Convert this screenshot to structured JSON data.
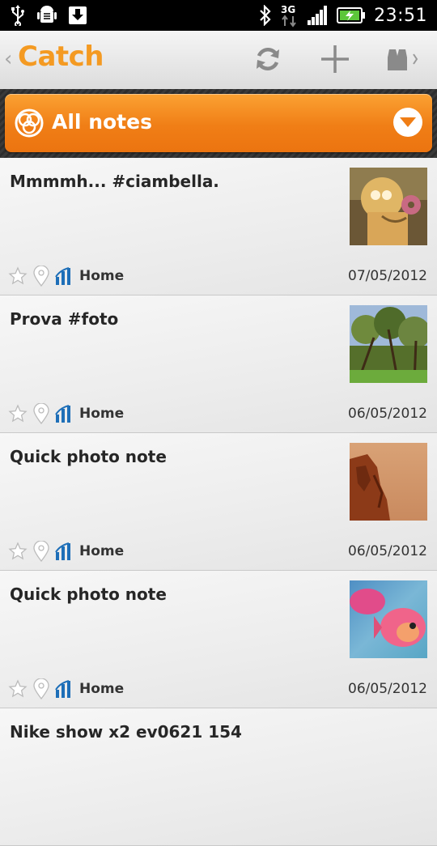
{
  "status_bar": {
    "time": "23:51",
    "network": "3G",
    "icons": [
      "usb-icon",
      "android-debug-icon",
      "download-icon",
      "bluetooth-icon",
      "network-3g-icon",
      "signal-icon",
      "battery-charging-icon"
    ]
  },
  "action_bar": {
    "title": "Catch",
    "actions": [
      "sync-icon",
      "add-icon",
      "search-binoculars-icon"
    ],
    "brand_color": "#f49a22"
  },
  "filter": {
    "label": "All notes",
    "accent": "#f07e16"
  },
  "notes": [
    {
      "title": "Mmmmh... #ciambella.",
      "tag": "Home",
      "date": "07/05/2012",
      "thumb": "homer-donut-photo"
    },
    {
      "title": "Prova #foto",
      "tag": "Home",
      "date": "06/05/2012",
      "thumb": "trees-sky-photo"
    },
    {
      "title": "Quick photo note",
      "tag": "Home",
      "date": "06/05/2012",
      "thumb": "rock-cliff-photo"
    },
    {
      "title": "Quick photo note",
      "tag": "Home",
      "date": "06/05/2012",
      "thumb": "pink-fish-photo"
    },
    {
      "title": "Nike show x2 ev0621 154"
    }
  ]
}
